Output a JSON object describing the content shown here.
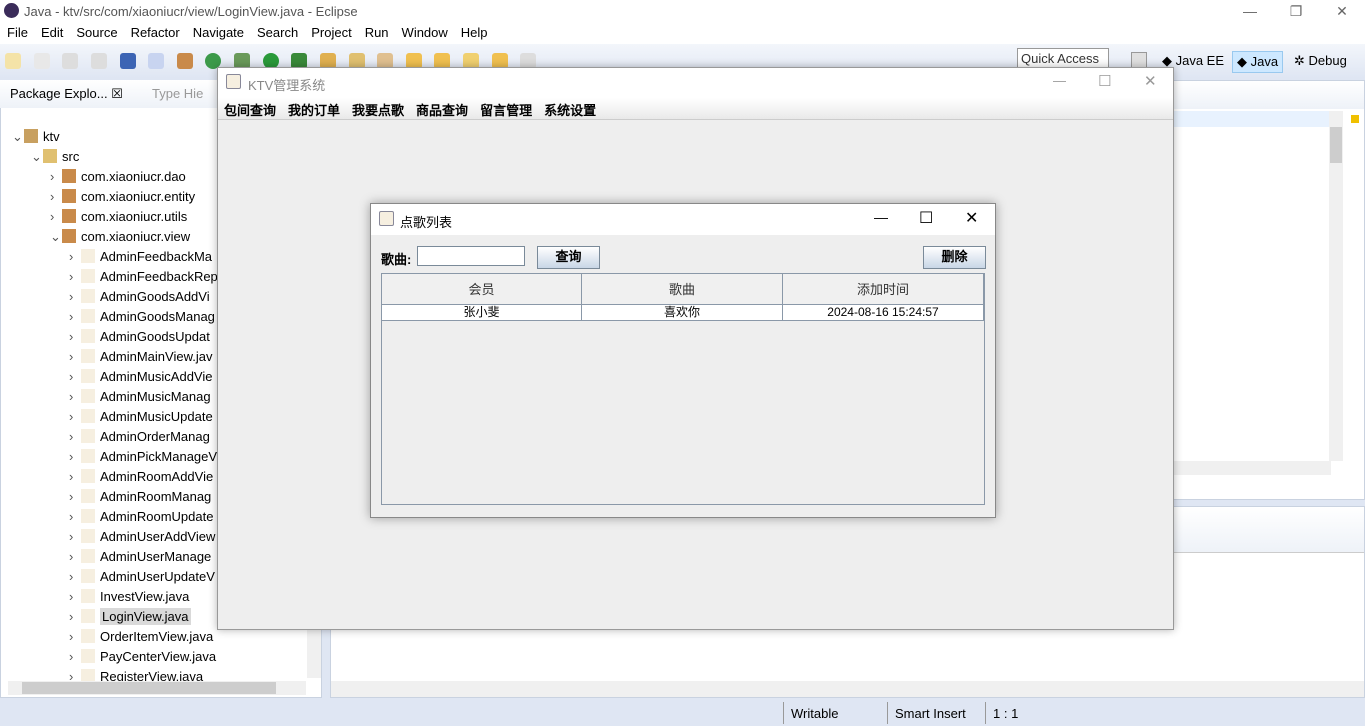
{
  "window": {
    "title": "Java - ktv/src/com/xiaoniucr/view/LoginView.java - Eclipse"
  },
  "menu": [
    "File",
    "Edit",
    "Source",
    "Refactor",
    "Navigate",
    "Search",
    "Project",
    "Run",
    "Window",
    "Help"
  ],
  "toolbar": {
    "quick_access": "Quick Access",
    "perspectives": [
      "Java EE",
      "Java",
      "Debug"
    ],
    "active_perspective": "Java"
  },
  "package_explorer": {
    "tab": "Package Explo...",
    "tab2": "Type Hie",
    "project": "ktv",
    "src": "src",
    "packages": [
      "com.xiaoniucr.dao",
      "com.xiaoniucr.entity",
      "com.xiaoniucr.utils",
      "com.xiaoniucr.view"
    ],
    "files": [
      "AdminFeedbackMa",
      "AdminFeedbackRep",
      "AdminGoodsAddVi",
      "AdminGoodsManag",
      "AdminGoodsUpdat",
      "AdminMainView.jav",
      "AdminMusicAddVie",
      "AdminMusicManag",
      "AdminMusicUpdate",
      "AdminOrderManag",
      "AdminPickManageV",
      "AdminRoomAddVie",
      "AdminRoomManag",
      "AdminRoomUpdate",
      "AdminUserAddView",
      "AdminUserManage",
      "AdminUserUpdateV",
      "InvestView.java",
      "LoginView.java",
      "OrderItemView.java",
      "PayCenterView.java",
      "RegisterView.java"
    ],
    "selected": "LoginView.java"
  },
  "status": {
    "writable": "Writable",
    "insert": "Smart Insert",
    "position": "1 : 1"
  },
  "ktv_window": {
    "title": "KTV管理系统",
    "menu": [
      "包间查询",
      "我的订单",
      "我要点歌",
      "商品查询",
      "留言管理",
      "系统设置"
    ]
  },
  "dialog": {
    "title": "点歌列表",
    "search_label": "歌曲:",
    "search_value": "",
    "query_button": "查询",
    "delete_button": "删除",
    "columns": [
      "会员",
      "歌曲",
      "添加时间"
    ],
    "rows": [
      [
        "张小斐",
        "喜欢你",
        "2024-08-16 15:24:57"
      ]
    ]
  },
  "colors": {
    "accent": "#dfe6f3",
    "selection": "#cde8ff"
  }
}
